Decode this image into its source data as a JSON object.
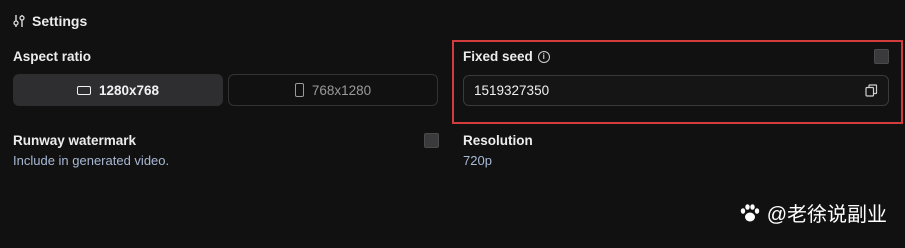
{
  "settings": {
    "title": "Settings",
    "icon": "sliders-icon"
  },
  "aspect_ratio": {
    "label": "Aspect ratio",
    "options": [
      {
        "label": "1280x768",
        "icon": "landscape-icon",
        "selected": true
      },
      {
        "label": "768x1280",
        "icon": "portrait-icon",
        "selected": false
      }
    ]
  },
  "fixed_seed": {
    "label": "Fixed seed",
    "info_icon": "info-icon",
    "checked": false,
    "value": "1519327350",
    "copy_icon": "copy-icon",
    "highlight_color": "#d23c3c"
  },
  "watermark_option": {
    "label": "Runway watermark",
    "description": "Include in generated video.",
    "checked": false
  },
  "resolution": {
    "label": "Resolution",
    "value": "720p"
  },
  "overlay_watermark": {
    "text": "@老徐说副业",
    "icon": "paw-icon"
  },
  "colors": {
    "background": "#111111",
    "accent_text": "#a8b8d4"
  }
}
